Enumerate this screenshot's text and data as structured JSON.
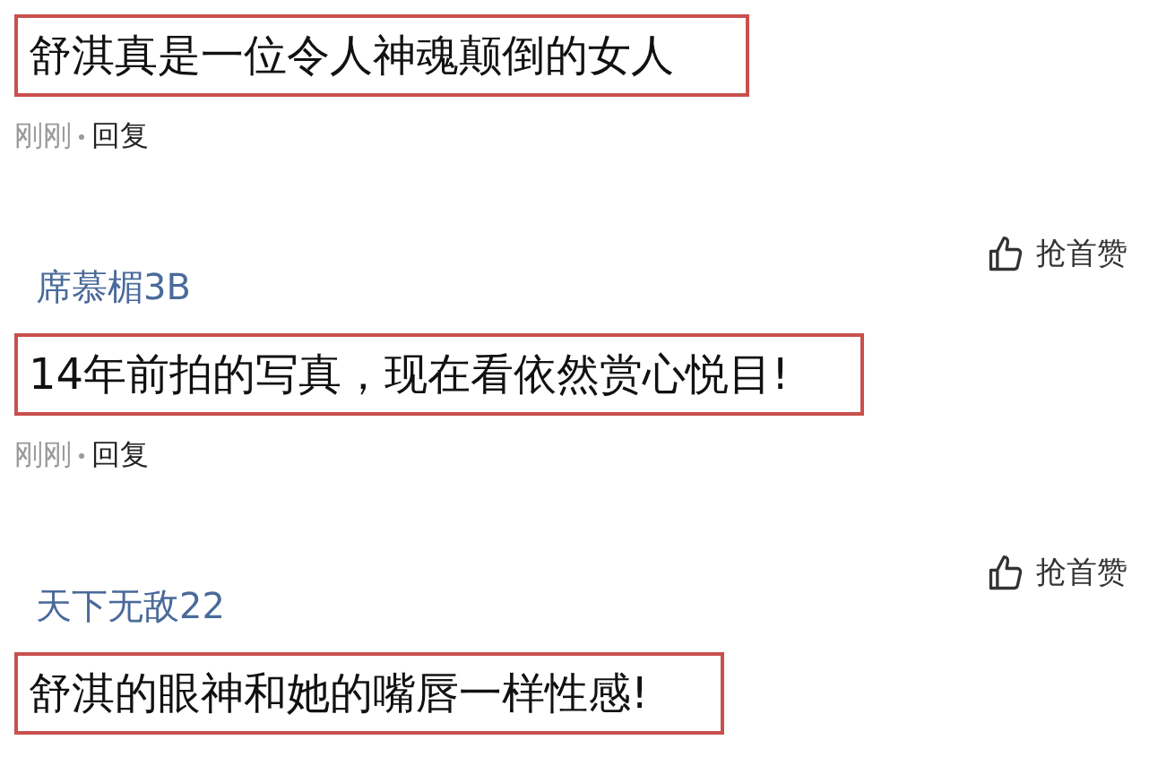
{
  "comments": [
    {
      "text": "舒淇真是一位令人神魂颠倒的女人",
      "time": "刚刚",
      "reply": "回复"
    },
    {
      "username": "席慕楣3B",
      "like": "抢首赞",
      "text": "14年前拍的写真，现在看依然赏心悦目!",
      "time": "刚刚",
      "reply": "回复"
    },
    {
      "username": "天下无敌22",
      "like": "抢首赞",
      "text": "舒淇的眼神和她的嘴唇一样性感!"
    }
  ]
}
